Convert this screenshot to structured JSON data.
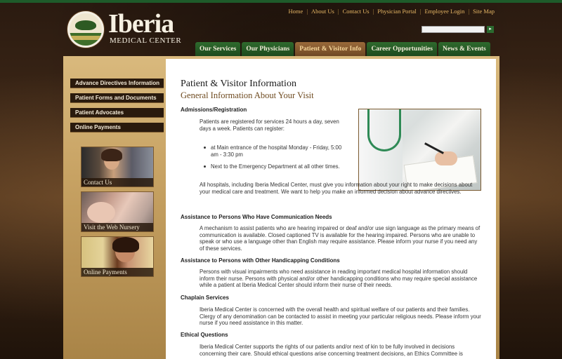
{
  "brand": {
    "name": "Iberia",
    "subtitle": "MEDICAL CENTER"
  },
  "utility_nav": [
    "Home",
    "About Us",
    "Contact Us",
    "Physician Portal",
    "Employee Login",
    "Site Map"
  ],
  "search": {
    "value": "",
    "go_label": "▸"
  },
  "main_nav": {
    "tabs": [
      "Our Services",
      "Our Physicians",
      "Patient & Visitor Info",
      "Career Opportunities",
      "News & Events"
    ],
    "active": "Patient & Visitor Info"
  },
  "sidebar": {
    "items": [
      "Advance Directives Information",
      "Patient Forms and Documents",
      "Patient Advocates",
      "Online Payments"
    ],
    "promos": [
      "Contact Us",
      "Visit the Web Nursery",
      "Online Payments"
    ]
  },
  "content": {
    "title": "Patient & Visitor Information",
    "subtitle": "General Information About Your Visit",
    "sections": [
      {
        "heading": "Admissions/Registration",
        "intro": "Patients are registered for services 24 hours a day, seven days a week.  Patients can register:",
        "bullets": [
          "at Main entrance of the hospital Monday - Friday, 5:00 am - 3:30 pm",
          "Next to the Emergency Department at all other times."
        ],
        "outro": "All hospitals, including Iberia Medical Center, must give you information about your right to make decisions about your medical care and treatment.  We want to help you make an informed decision about advance directives."
      },
      {
        "heading": "Assistance to Persons Who Have Communication Needs",
        "body": "A mechanism to assist patients who are hearing impaired or deaf and/or use sign language as the primary means of communication is available. Closed captioned TV is available for the hearing impaired. Persons who are unable to speak or who use a language other than English may require assistance. Please inform your nurse if you need any of these services."
      },
      {
        "heading": "Assistance to Persons with Other Handicapping Conditions",
        "body": "Persons with visual impairments who need assistance in reading important medical hospital information should inform their nurse. Persons with physical and/or other handicapping conditions who may require special assistance while a patient at Iberia Medical Center should inform their nurse of their needs."
      },
      {
        "heading": "Chaplain Services",
        "body": "Iberia Medical Center is concerned with the overall health and spiritual welfare of our patients and their families. Clergy of any denomination can be contacted to assist in meeting your particular religious needs. Please inform your nurse if you need assistance in this matter."
      },
      {
        "heading": "Ethical Questions",
        "body": "Iberia Medical Center supports the rights of our patients and/or next of kin to be fully involved in decisions concerning their care. Should ethical questions arise concerning treatment decisions, an Ethics Committee is"
      }
    ]
  }
}
